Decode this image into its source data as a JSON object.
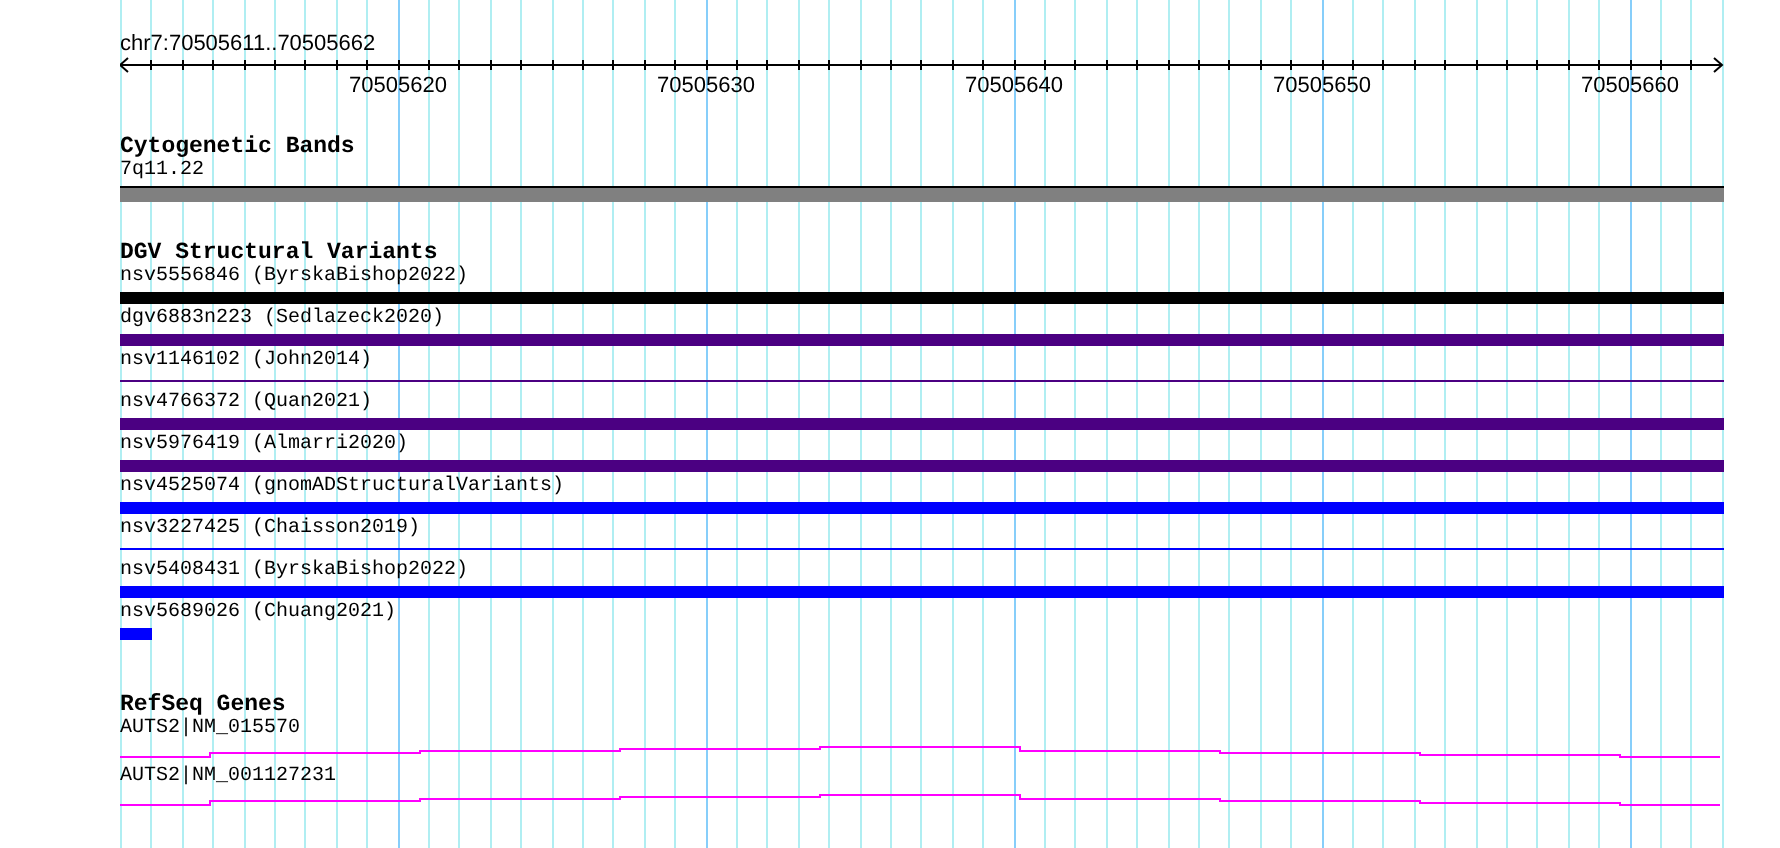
{
  "ruler": {
    "location": "chr7:70505611..70505662",
    "ticks": [
      "70505620",
      "70505630",
      "70505640",
      "70505650",
      "70505660"
    ]
  },
  "tracks": [
    {
      "kind": "cytoband",
      "title": "Cytogenetic Bands",
      "features": [
        {
          "label": "7q11.22",
          "kind": "thick",
          "color": "#808080"
        }
      ]
    },
    {
      "kind": "variants",
      "title": "DGV Structural Variants",
      "features": [
        {
          "label": "nsv5556846 (ByrskaBishop2022)",
          "kind": "thick",
          "color": "#000000"
        },
        {
          "label": "dgv6883n223 (Sedlazeck2020)",
          "kind": "thick",
          "color": "#4b0082"
        },
        {
          "label": "nsv1146102 (John2014)",
          "kind": "thin",
          "color": "#4b0082"
        },
        {
          "label": "nsv4766372 (Quan2021)",
          "kind": "thick",
          "color": "#4b0082"
        },
        {
          "label": "nsv5976419 (Almarri2020)",
          "kind": "thick",
          "color": "#4b0082"
        },
        {
          "label": "nsv4525074 (gnomADStructuralVariants)",
          "kind": "thick",
          "color": "#0000ff"
        },
        {
          "label": "nsv3227425 (Chaisson2019)",
          "kind": "thin",
          "color": "#0000ff"
        },
        {
          "label": "nsv5408431 (ByrskaBishop2022)",
          "kind": "thick",
          "color": "#0000ff"
        },
        {
          "label": "nsv5689026 (Chuang2021)",
          "kind": "stub",
          "color": "#0000ff"
        }
      ]
    },
    {
      "kind": "genes",
      "title": "RefSeq Genes",
      "features": [
        {
          "label": "AUTS2|NM_015570",
          "kind": "transcript",
          "color": "#ff00ff"
        },
        {
          "label": "AUTS2|NM_001127231",
          "kind": "transcript",
          "color": "#ff00ff"
        }
      ]
    }
  ]
}
